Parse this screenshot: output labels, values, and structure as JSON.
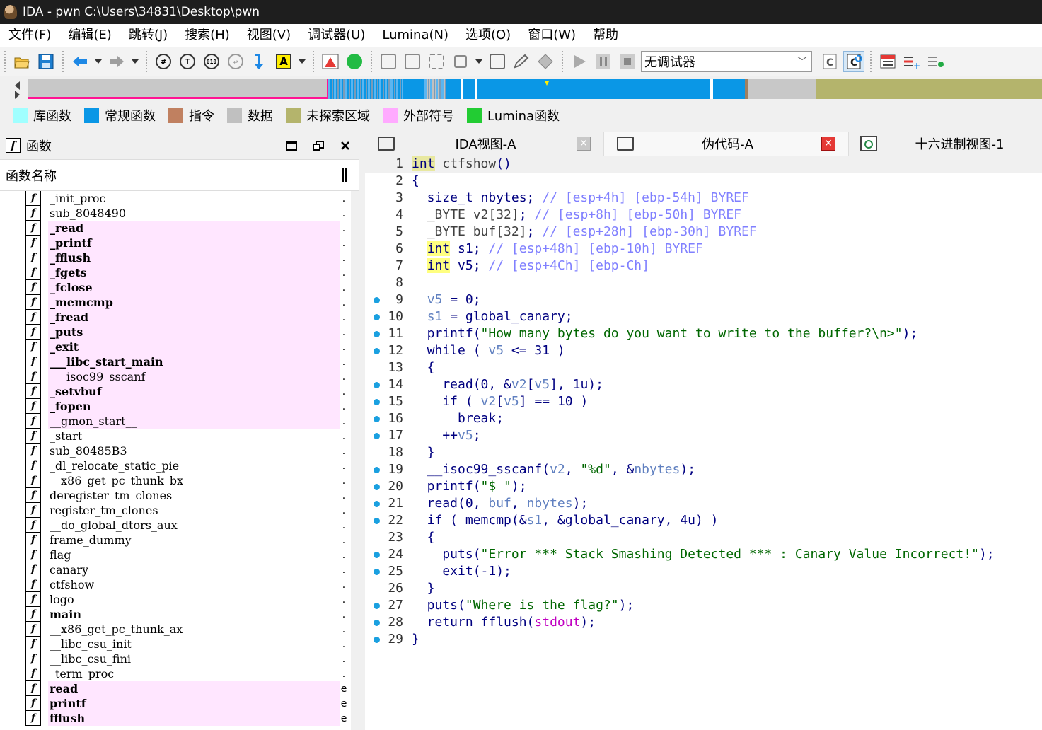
{
  "window": {
    "title": "IDA - pwn C:\\Users\\34831\\Desktop\\pwn"
  },
  "menu": [
    "文件(F)",
    "编辑(E)",
    "跳转(J)",
    "搜索(H)",
    "视图(V)",
    "调试器(U)",
    "Lumina(N)",
    "选项(O)",
    "窗口(W)",
    "帮助"
  ],
  "toolbar": {
    "debugger_select": "无调试器",
    "text_color_letter": "A"
  },
  "legend": [
    {
      "label": "库函数",
      "color": "#a0ffff"
    },
    {
      "label": "常规函数",
      "color": "#0a97e6"
    },
    {
      "label": "指令",
      "color": "#c08060"
    },
    {
      "label": "数据",
      "color": "#c0c0c0"
    },
    {
      "label": "未探索区域",
      "color": "#b4b46c"
    },
    {
      "label": "外部符号",
      "color": "#ffaaff"
    },
    {
      "label": "Lumina函数",
      "color": "#22cc33"
    }
  ],
  "functions_panel": {
    "title": "函数",
    "column_header": "函数名称",
    "items": [
      {
        "name": "_init_proc",
        "style": "normal",
        "tail": "."
      },
      {
        "name": "sub_8048490",
        "style": "normal",
        "tail": "."
      },
      {
        "name": "_read",
        "style": "pink-bold",
        "tail": "."
      },
      {
        "name": "_printf",
        "style": "pink-bold",
        "tail": "."
      },
      {
        "name": "_fflush",
        "style": "pink-bold",
        "tail": "."
      },
      {
        "name": "_fgets",
        "style": "pink-bold",
        "tail": "."
      },
      {
        "name": "_fclose",
        "style": "pink-bold",
        "tail": "."
      },
      {
        "name": "_memcmp",
        "style": "pink-bold",
        "tail": "."
      },
      {
        "name": "_fread",
        "style": "pink-bold",
        "tail": "."
      },
      {
        "name": "_puts",
        "style": "pink-bold",
        "tail": "."
      },
      {
        "name": "_exit",
        "style": "pink-bold",
        "tail": "."
      },
      {
        "name": "___libc_start_main",
        "style": "pink-bold",
        "tail": "."
      },
      {
        "name": "___isoc99_sscanf",
        "style": "pink",
        "tail": "."
      },
      {
        "name": "_setvbuf",
        "style": "pink-bold",
        "tail": "."
      },
      {
        "name": "_fopen",
        "style": "pink-bold",
        "tail": "."
      },
      {
        "name": "__gmon_start__",
        "style": "pink",
        "tail": "."
      },
      {
        "name": "_start",
        "style": "normal",
        "tail": "."
      },
      {
        "name": "sub_80485B3",
        "style": "normal",
        "tail": "."
      },
      {
        "name": "_dl_relocate_static_pie",
        "style": "normal",
        "tail": "."
      },
      {
        "name": "__x86_get_pc_thunk_bx",
        "style": "normal",
        "tail": "."
      },
      {
        "name": "deregister_tm_clones",
        "style": "normal",
        "tail": "."
      },
      {
        "name": "register_tm_clones",
        "style": "normal",
        "tail": "."
      },
      {
        "name": "__do_global_dtors_aux",
        "style": "normal",
        "tail": "."
      },
      {
        "name": "frame_dummy",
        "style": "normal",
        "tail": "."
      },
      {
        "name": "flag",
        "style": "normal",
        "tail": "."
      },
      {
        "name": "canary",
        "style": "normal",
        "tail": "."
      },
      {
        "name": "ctfshow",
        "style": "normal",
        "tail": "."
      },
      {
        "name": "logo",
        "style": "normal",
        "tail": "."
      },
      {
        "name": "main",
        "style": "bold",
        "tail": "."
      },
      {
        "name": "__x86_get_pc_thunk_ax",
        "style": "normal",
        "tail": "."
      },
      {
        "name": "__libc_csu_init",
        "style": "normal",
        "tail": "."
      },
      {
        "name": "__libc_csu_fini",
        "style": "normal",
        "tail": "."
      },
      {
        "name": "_term_proc",
        "style": "normal",
        "tail": "."
      },
      {
        "name": "read",
        "style": "pink-bold",
        "tail": "e"
      },
      {
        "name": "printf",
        "style": "pink-bold",
        "tail": "e"
      },
      {
        "name": "fflush",
        "style": "pink-bold",
        "tail": "e"
      }
    ]
  },
  "tabs": [
    {
      "label": "IDA视图-A",
      "close": "gray"
    },
    {
      "label": "伪代码-A",
      "close": "red"
    },
    {
      "label": "十六进制视图-1",
      "close": "none"
    }
  ],
  "pseudocode": {
    "lines": [
      {
        "n": "1",
        "dot": false,
        "html": "<span class=\"cursor-int\">int</span> <span style=\"color:#404040\">ctfshow</span>()"
      },
      {
        "n": "2",
        "dot": false,
        "html": "{"
      },
      {
        "n": "3",
        "dot": false,
        "html": "  size_t nbytes; <span class=\"cm\">// [esp+4h] [ebp-54h] BYREF</span>"
      },
      {
        "n": "4",
        "dot": false,
        "html": "  <span style=\"color:#404040\">_BYTE v2[32]</span>; <span class=\"cm\">// [esp+8h] [ebp-50h] BYREF</span>"
      },
      {
        "n": "5",
        "dot": false,
        "html": "  <span style=\"color:#404040\">_BYTE buf[32]</span>; <span class=\"cm\">// [esp+28h] [ebp-30h] BYREF</span>"
      },
      {
        "n": "6",
        "dot": false,
        "html": "  <span class=\"hl\">int</span> s1; <span class=\"cm\">// [esp+48h] [ebp-10h] BYREF</span>"
      },
      {
        "n": "7",
        "dot": false,
        "html": "  <span class=\"hl\">int</span> v5; <span class=\"cm\">// [esp+4Ch] [ebp-Ch]</span>"
      },
      {
        "n": "8",
        "dot": false,
        "html": ""
      },
      {
        "n": "9",
        "dot": true,
        "html": "  <span class=\"var\">v5</span> = 0;"
      },
      {
        "n": "10",
        "dot": true,
        "html": "  <span class=\"var\">s1</span> = global_canary;"
      },
      {
        "n": "11",
        "dot": true,
        "html": "  printf(<span class=\"str\">\"How many bytes do you want to write to the buffer?\\n>\"</span>);"
      },
      {
        "n": "12",
        "dot": true,
        "html": "  while ( <span class=\"var\">v5</span> &lt;= 31 )"
      },
      {
        "n": "13",
        "dot": false,
        "html": "  {"
      },
      {
        "n": "14",
        "dot": true,
        "html": "    read(0, &amp;<span class=\"var\">v2</span>[<span class=\"var\">v5</span>], 1u);"
      },
      {
        "n": "15",
        "dot": true,
        "html": "    if ( <span class=\"var\">v2</span>[<span class=\"var\">v5</span>] == 10 )"
      },
      {
        "n": "16",
        "dot": true,
        "html": "      break;"
      },
      {
        "n": "17",
        "dot": true,
        "html": "    ++<span class=\"var\">v5</span>;"
      },
      {
        "n": "18",
        "dot": false,
        "html": "  }"
      },
      {
        "n": "19",
        "dot": true,
        "html": "  __isoc99_sscanf(<span class=\"var\">v2</span>, <span class=\"str\">\"%d\"</span>, &amp;<span class=\"var\">nbytes</span>);"
      },
      {
        "n": "20",
        "dot": true,
        "html": "  printf(<span class=\"str\">\"$ \"</span>);"
      },
      {
        "n": "21",
        "dot": true,
        "html": "  read(0, <span class=\"var\">buf</span>, <span class=\"var\">nbytes</span>);"
      },
      {
        "n": "22",
        "dot": true,
        "html": "  if ( memcmp(&amp;<span class=\"var\">s1</span>, &amp;global_canary, 4u) )"
      },
      {
        "n": "23",
        "dot": false,
        "html": "  {"
      },
      {
        "n": "24",
        "dot": true,
        "html": "    puts(<span class=\"str\">\"Error *** Stack Smashing Detected *** : Canary Value Incorrect!\"</span>);"
      },
      {
        "n": "25",
        "dot": true,
        "html": "    exit(-1);"
      },
      {
        "n": "26",
        "dot": false,
        "html": "  }"
      },
      {
        "n": "27",
        "dot": true,
        "html": "  puts(<span class=\"str\">\"Where is the flag?\"</span>);"
      },
      {
        "n": "28",
        "dot": true,
        "html": "  return fflush(<span class=\"im\">stdout</span>);"
      },
      {
        "n": "29",
        "dot": true,
        "html": "}"
      }
    ]
  }
}
